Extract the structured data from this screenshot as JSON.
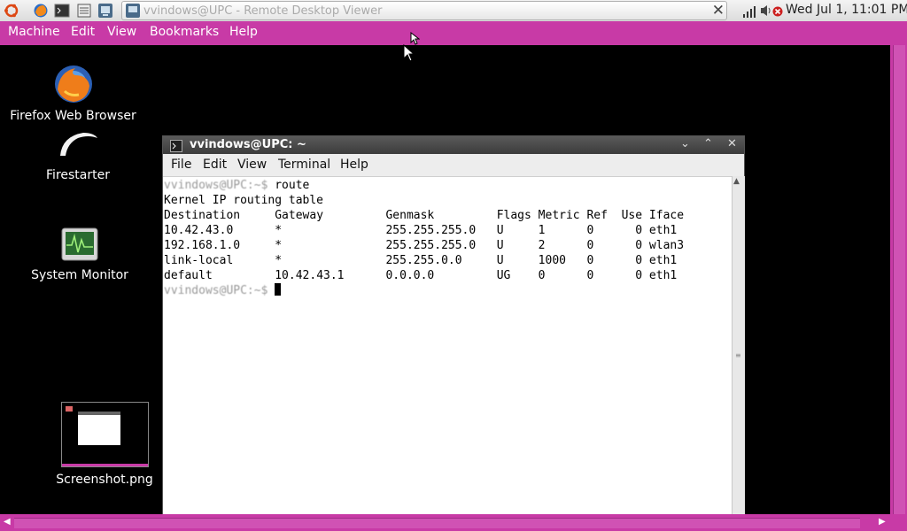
{
  "top_panel": {
    "launchers": [
      {
        "name": "ubuntu-menu-icon"
      },
      {
        "name": "firefox-launcher-icon"
      },
      {
        "name": "terminal-launcher-icon"
      },
      {
        "name": "notes-launcher-icon"
      },
      {
        "name": "remote-desktop-launcher-icon"
      }
    ],
    "window_button": {
      "title": "vvindows@UPC - Remote Desktop Viewer"
    },
    "clock": "Wed Jul  1, 11:01 PM"
  },
  "viewer": {
    "menu": [
      "Machine",
      "Edit",
      "View",
      "Bookmarks",
      "Help"
    ]
  },
  "desktop": {
    "icons": [
      {
        "label": "Firefox Web Browser",
        "icon": "firefox-icon"
      },
      {
        "label": "Firestarter",
        "icon": "firestarter-icon"
      },
      {
        "label": "System Monitor",
        "icon": "system-monitor-icon"
      },
      {
        "label": "Screenshot.png",
        "icon": "image-thumbnail-icon"
      }
    ]
  },
  "terminal": {
    "title": "vvindows@UPC: ~",
    "menu": [
      "File",
      "Edit",
      "View",
      "Terminal",
      "Help"
    ],
    "command_prompt": "vvindows@UPC:~$",
    "command": "route",
    "header": "Kernel IP routing table",
    "columns": [
      "Destination",
      "Gateway",
      "Genmask",
      "Flags",
      "Metric",
      "Ref",
      "Use",
      "Iface"
    ],
    "rows": [
      [
        "10.42.43.0",
        "*",
        "255.255.255.0",
        "U",
        "1",
        "0",
        "0",
        "eth1"
      ],
      [
        "192.168.1.0",
        "*",
        "255.255.255.0",
        "U",
        "2",
        "0",
        "0",
        "wlan3"
      ],
      [
        "link-local",
        "*",
        "255.255.0.0",
        "U",
        "1000",
        "0",
        "0",
        "eth1"
      ],
      [
        "default",
        "10.42.43.1",
        "0.0.0.0",
        "UG",
        "0",
        "0",
        "0",
        "eth1"
      ]
    ],
    "current_prompt": "vvindows@UPC:~$"
  }
}
